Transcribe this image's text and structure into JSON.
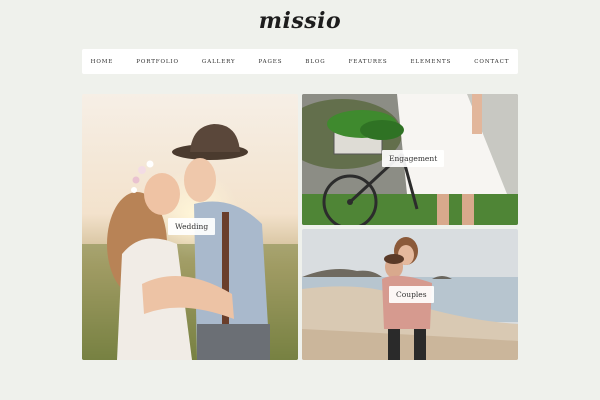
{
  "brand": {
    "logo": "missio"
  },
  "nav": {
    "items": [
      "HOME",
      "PORTFOLIO",
      "GALLERY",
      "PAGES",
      "BLOG",
      "FEATURES",
      "ELEMENTS",
      "CONTACT"
    ]
  },
  "gallery": {
    "tiles": [
      {
        "label": "Wedding",
        "image": "couple-kissing-sunset-photo"
      },
      {
        "label": "Engagement",
        "image": "bicycle-flower-basket-photo"
      },
      {
        "label": "Couples",
        "image": "couple-piggyback-beach-photo"
      }
    ]
  }
}
